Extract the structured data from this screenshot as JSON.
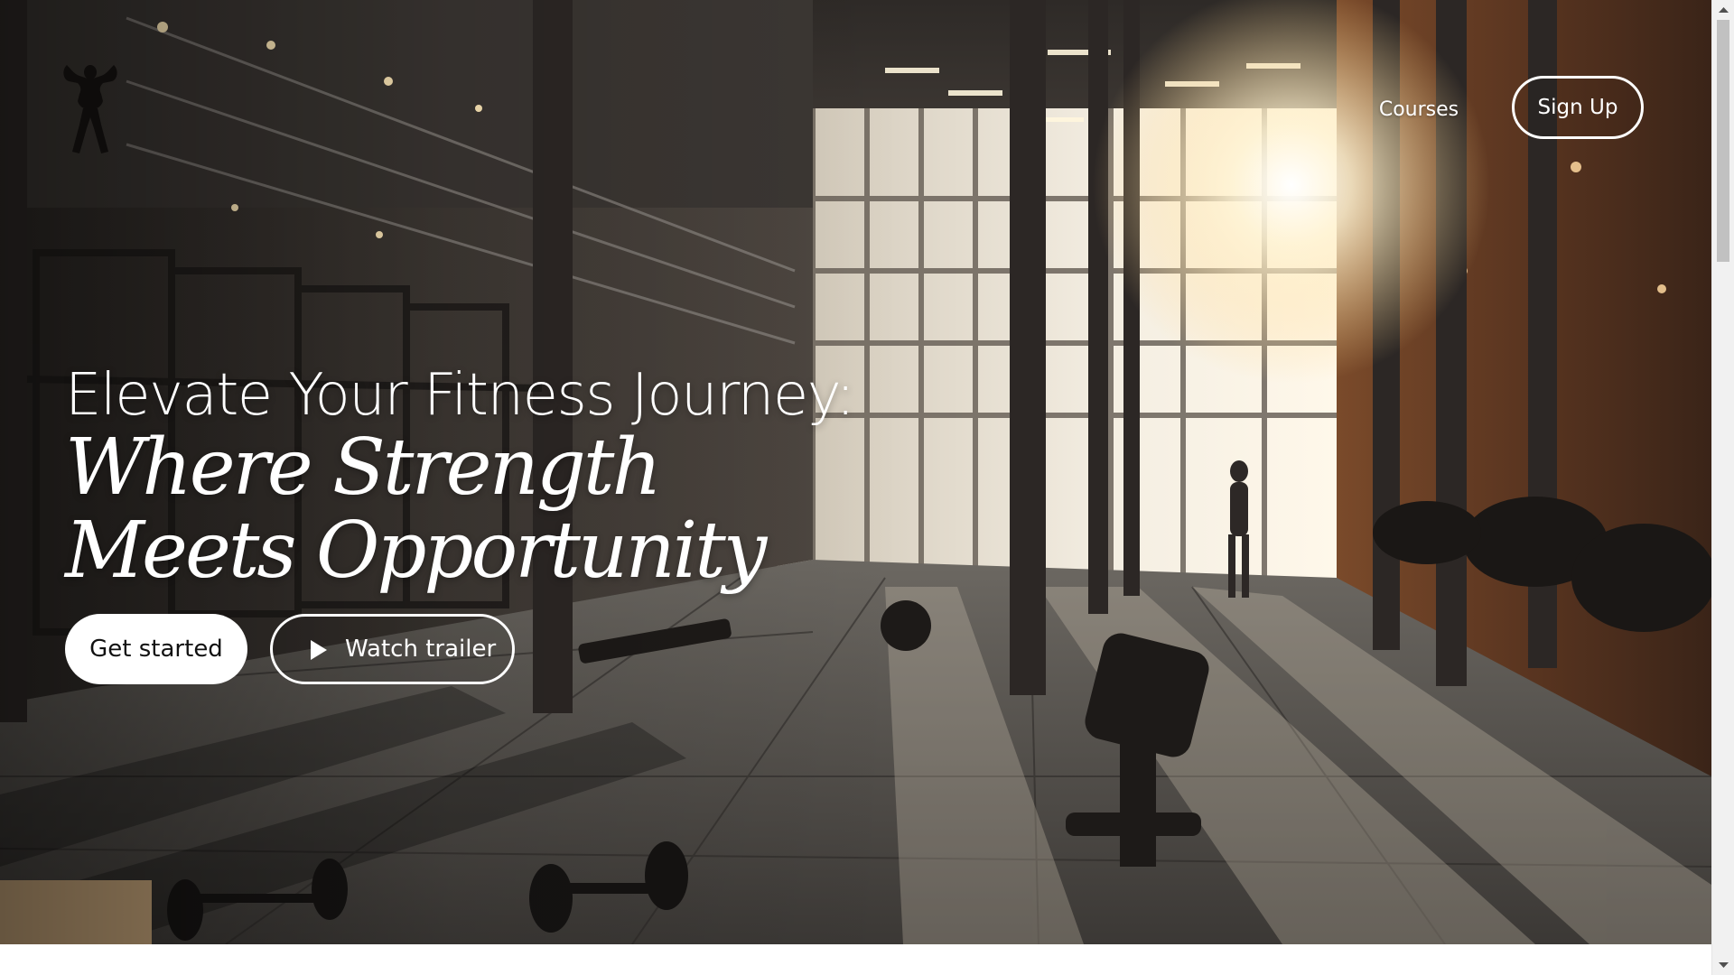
{
  "nav": {
    "logo_icon": "bodybuilder-silhouette-icon",
    "links": [
      "Courses"
    ],
    "signup_label": "Sign Up"
  },
  "hero": {
    "headline_line1": "Elevate Your Fitness Journey:",
    "headline_line2": "Where Strength Meets Opportunity",
    "primary_cta": "Get started",
    "secondary_cta": "Watch trailer",
    "secondary_cta_icon": "play-icon",
    "background_description_icon": "gym-interior-photo"
  },
  "scrollbar": {
    "up_icon": "scroll-up-arrow-icon",
    "down_icon": "scroll-down-arrow-icon"
  },
  "colors": {
    "text_on_hero": "#ffffff",
    "primary_button_bg": "#ffffff",
    "primary_button_text": "#111111"
  }
}
